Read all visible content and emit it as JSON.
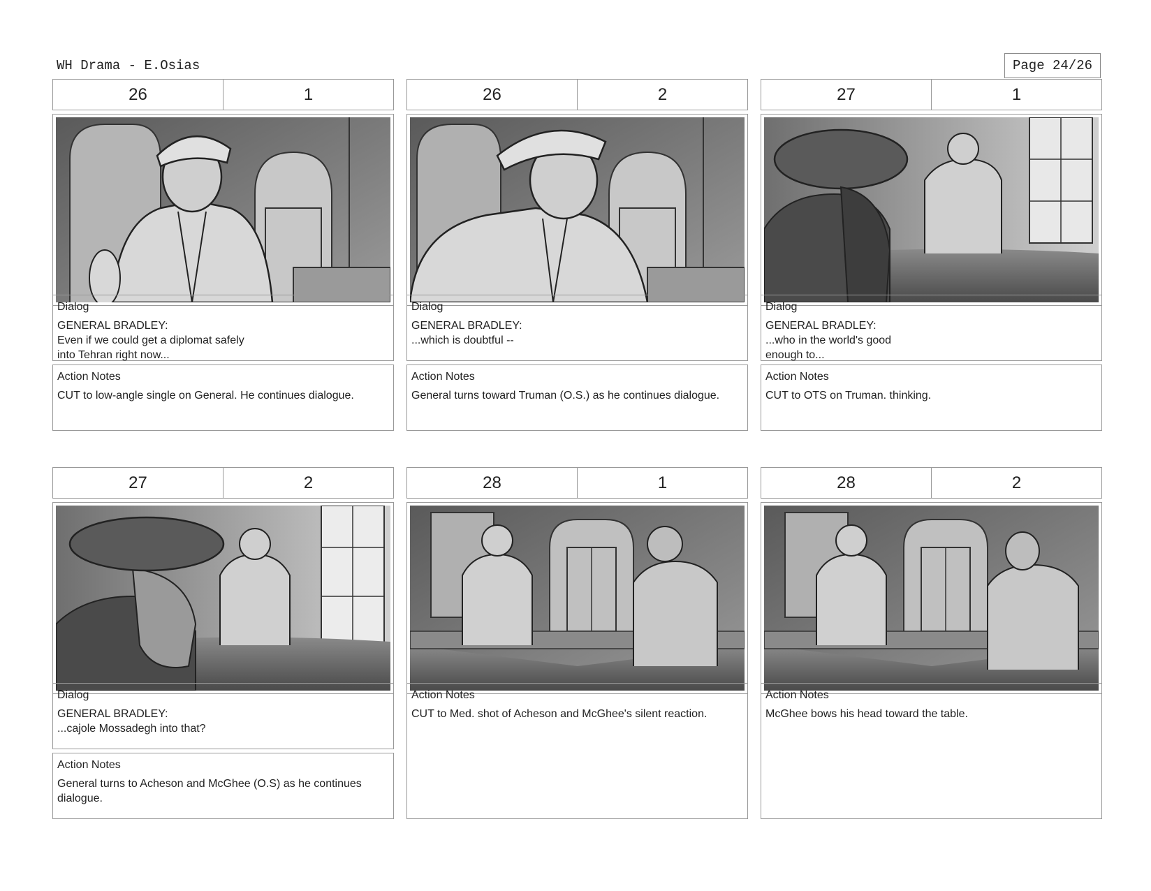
{
  "header": {
    "title": "WH Drama - E.Osias",
    "page": "Page 24/26"
  },
  "panels": [
    {
      "scene": "26",
      "shot": "1",
      "dialog": {
        "label": "Dialog",
        "text": "GENERAL BRADLEY:\nEven if we could get a diplomat safely\ninto Tehran right now..."
      },
      "action": {
        "label": "Action Notes",
        "text": "CUT to low-angle single on General. He continues dialogue."
      }
    },
    {
      "scene": "26",
      "shot": "2",
      "dialog": {
        "label": "Dialog",
        "text": "GENERAL BRADLEY:\n...which is doubtful --"
      },
      "action": {
        "label": "Action Notes",
        "text": "General turns toward Truman (O.S.) as he continues dialogue."
      }
    },
    {
      "scene": "27",
      "shot": "1",
      "dialog": {
        "label": "Dialog",
        "text": "GENERAL BRADLEY:\n...who in the world's good\nenough to..."
      },
      "action": {
        "label": "Action Notes",
        "text": "CUT to OTS on Truman. thinking."
      }
    },
    {
      "scene": "27",
      "shot": "2",
      "dialog": {
        "label": "Dialog",
        "text": "GENERAL BRADLEY:\n...cajole Mossadegh into that?"
      },
      "action": {
        "label": "Action Notes",
        "text": "General turns to Acheson and McGhee (O.S) as he continues\ndialogue."
      }
    },
    {
      "scene": "28",
      "shot": "1",
      "action": {
        "label": "Action Notes",
        "text": "CUT to Med. shot of Acheson and McGhee's silent reaction."
      }
    },
    {
      "scene": "28",
      "shot": "2",
      "action": {
        "label": "Action Notes",
        "text": "McGhee bows his head toward the table."
      }
    }
  ]
}
